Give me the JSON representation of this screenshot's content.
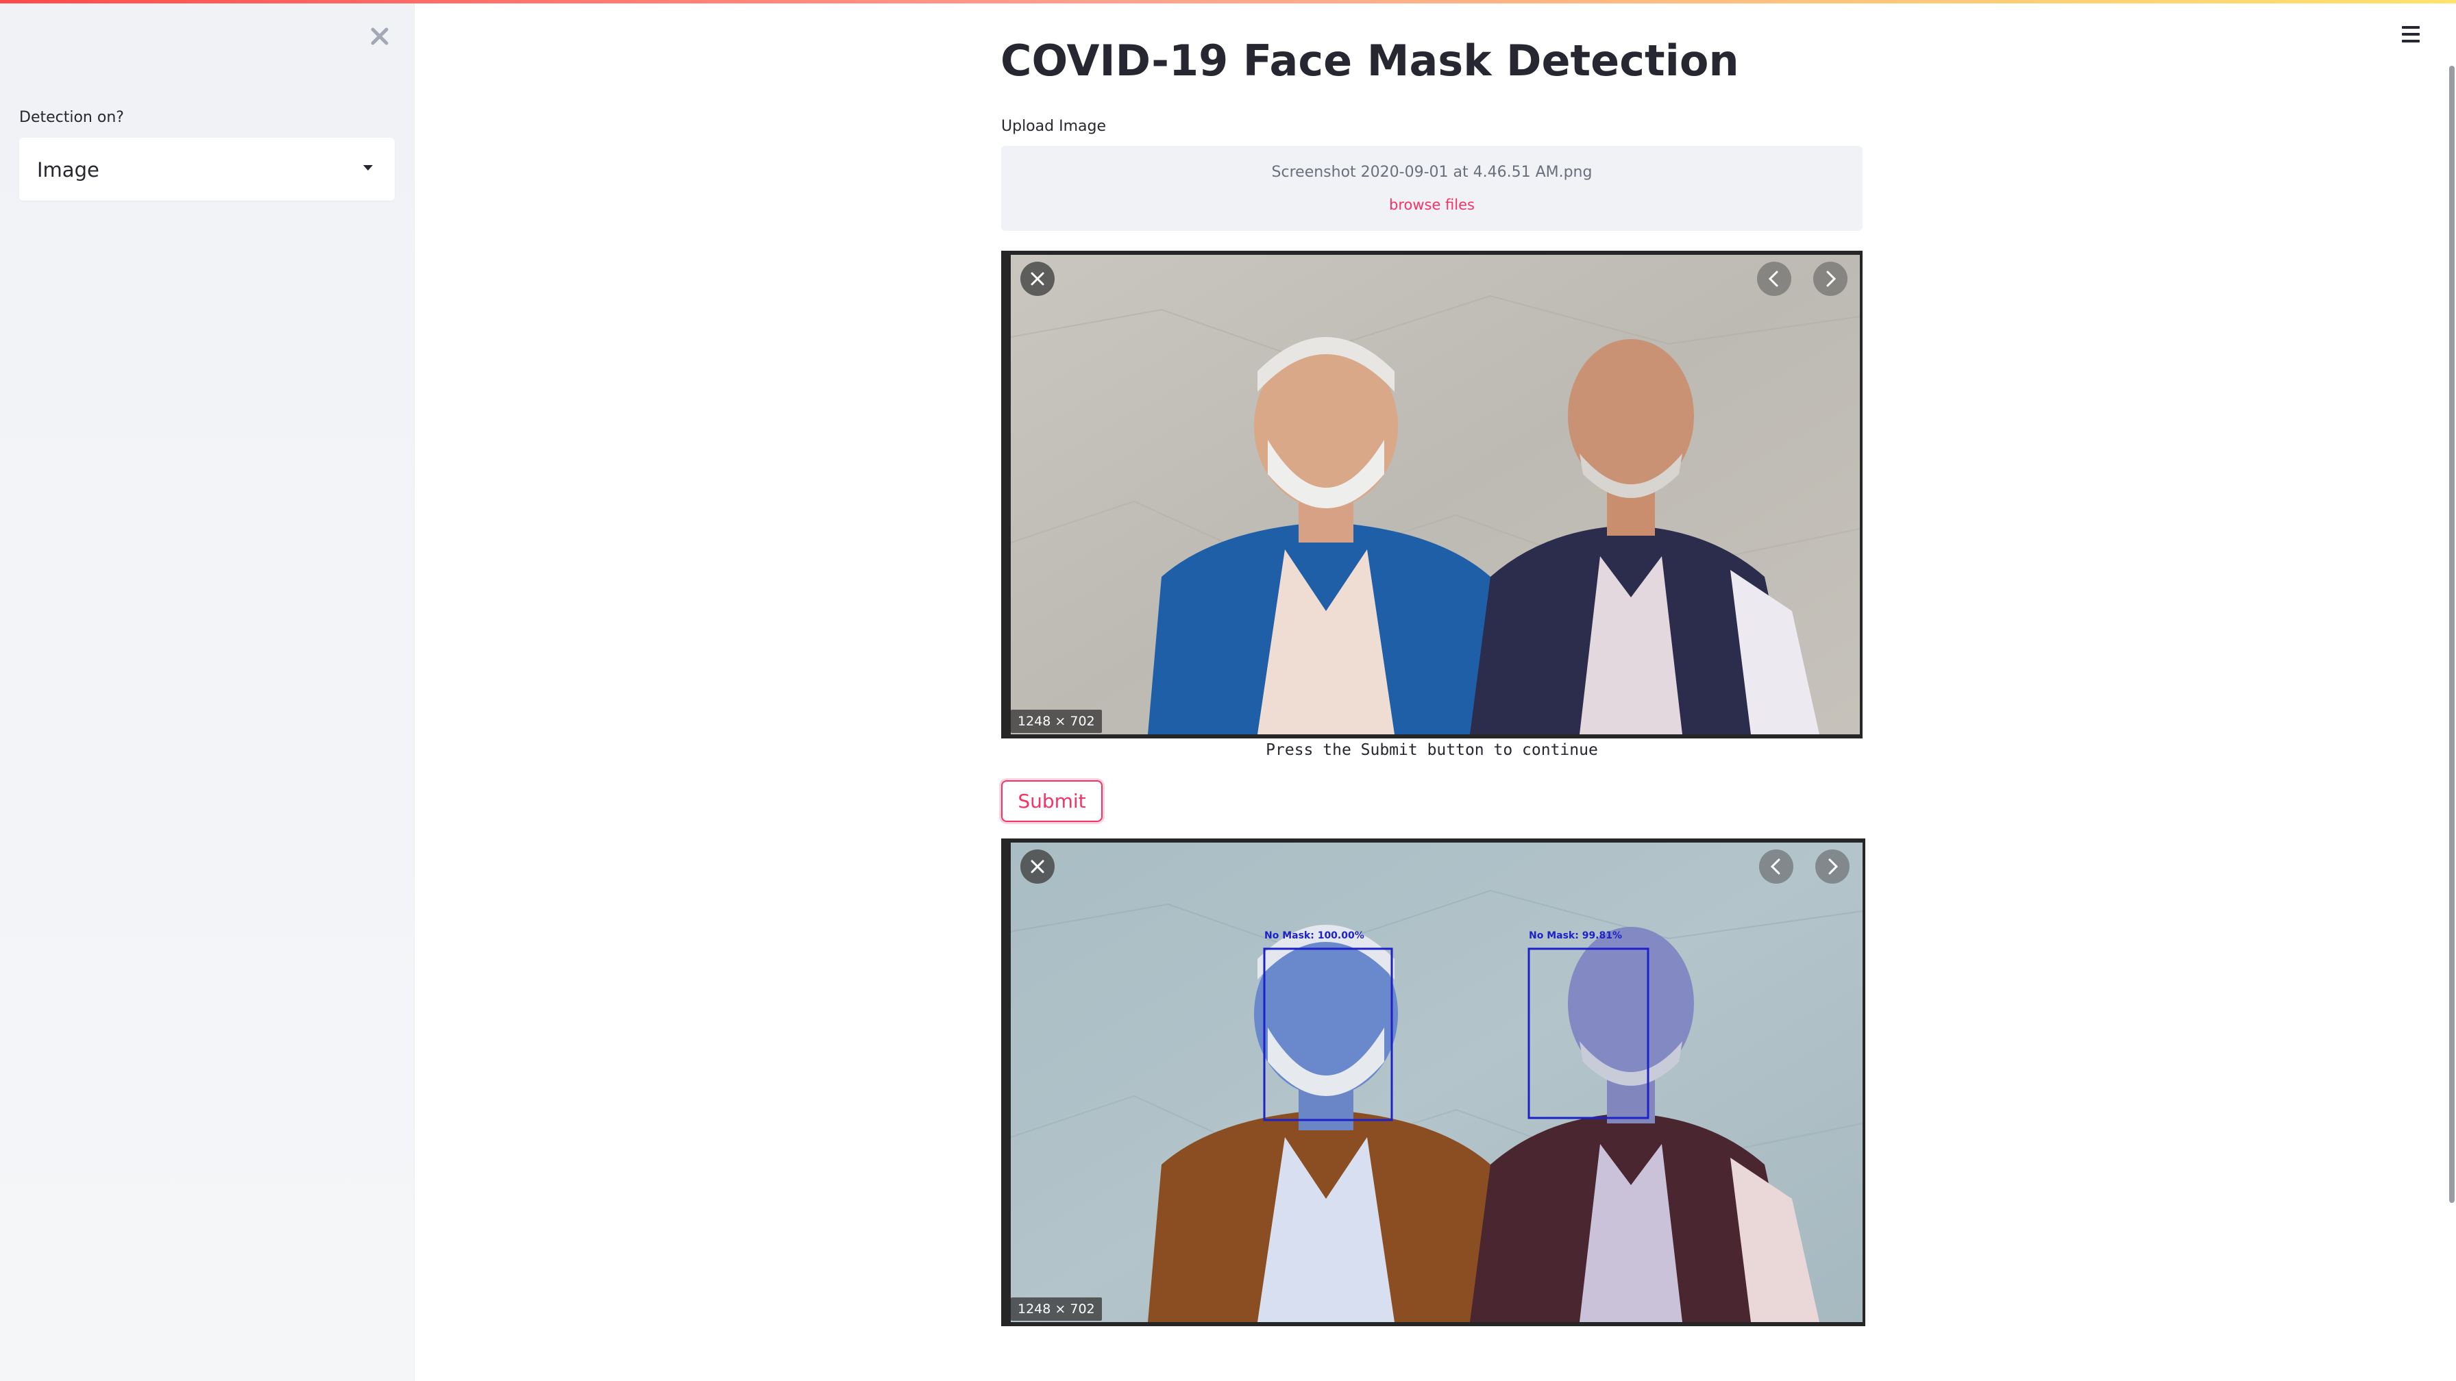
{
  "app": {
    "title": "COVID-19 Face Mask Detection",
    "accent_color": "#f63366"
  },
  "sidebar": {
    "close_icon": "close-icon",
    "select_label": "Detection on?",
    "select_value": "Image"
  },
  "header": {
    "menu_icon": "hamburger-menu-icon"
  },
  "uploader": {
    "label": "Upload Image",
    "file_name": "Screenshot 2020-09-01 at 4.46.51 AM.png",
    "browse_label": "browse files"
  },
  "input_image": {
    "dimensions": "1248 × 702",
    "caption": "Press the Submit button to continue"
  },
  "submit": {
    "label": "Submit"
  },
  "output_image": {
    "dimensions": "1248 × 702",
    "detections": [
      {
        "label": "No Mask: 100.00%"
      },
      {
        "label": "No Mask: 99.81%"
      }
    ]
  }
}
